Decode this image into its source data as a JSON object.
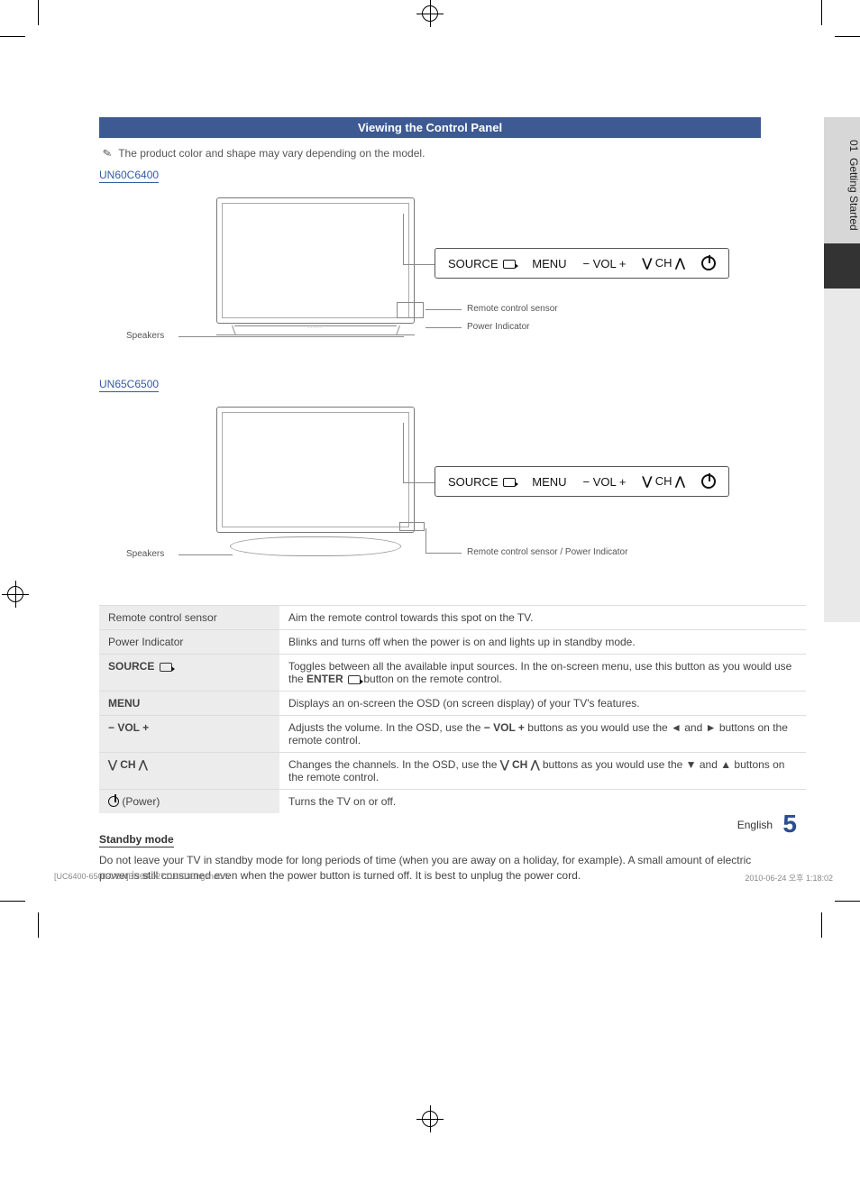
{
  "tab": {
    "chapter_no": "01",
    "chapter_title": "Getting Started"
  },
  "header": {
    "title": "Viewing the Control Panel"
  },
  "note": {
    "icon": "✎",
    "text": "The product color and shape may vary depending on the model."
  },
  "models": {
    "m1": {
      "name": "UN60C6400",
      "speakers_label": "Speakers",
      "callouts": {
        "rc_sensor": "Remote control sensor",
        "power_ind": "Power Indicator"
      }
    },
    "m2": {
      "name": "UN65C6500",
      "speakers_label": "Speakers",
      "callouts": {
        "combined": "Remote control sensor / Power Indicator"
      }
    }
  },
  "strip": {
    "source": "SOURCE",
    "menu": "MENU",
    "vol": "−  VOL  +",
    "ch_left": "⋁",
    "ch_mid": "CH",
    "ch_right": "⋀"
  },
  "table": {
    "rows": [
      {
        "label": "Remote control sensor",
        "desc": "Aim the remote control towards this spot on the TV."
      },
      {
        "label": "Power Indicator",
        "desc": "Blinks and turns off when the power is on and lights up in standby mode."
      },
      {
        "label": "SOURCE",
        "label_icon": "enter",
        "desc_a": "Toggles between all the available input sources. In the on-screen menu, use this button as you would use the ",
        "enter_label": "ENTER",
        "desc_b": " button on the remote control."
      },
      {
        "label": "MENU",
        "desc": "Displays an on-screen the OSD (on screen display) of your TV's features."
      },
      {
        "label": "− VOL +",
        "desc_a": "Adjusts the volume. In the OSD, use the ",
        "bold_mid": "− VOL +",
        "desc_b": " buttons as you would use the ◄ and ► buttons on the remote control."
      },
      {
        "label_a": "⋁",
        "label_mid": " CH ",
        "label_b": "⋀",
        "desc_a": "Changes the channels. In the OSD, use the ",
        "bold_a": "⋁",
        "bold_mid": " CH ",
        "bold_b": "⋀",
        "desc_b": " buttons as you would use the ▼ and ▲ buttons on the remote control."
      },
      {
        "label_icon": "power",
        "label_suffix": " (Power)",
        "desc": "Turns the TV on or off."
      }
    ]
  },
  "standby": {
    "heading": "Standby mode",
    "body": "Do not leave your TV in standby mode for long periods of time (when you are away on a holiday, for example). A small amount of electric power is still consumed even when the power button is turned off. It is best to unplug the power cord."
  },
  "footer": {
    "lang": "English",
    "page": "5"
  },
  "print": {
    "file": "[UC6400-6500-USA]BN68-02711E-03Eng.indb   5",
    "stamp": "2010-06-24   오후 1:18:02"
  }
}
